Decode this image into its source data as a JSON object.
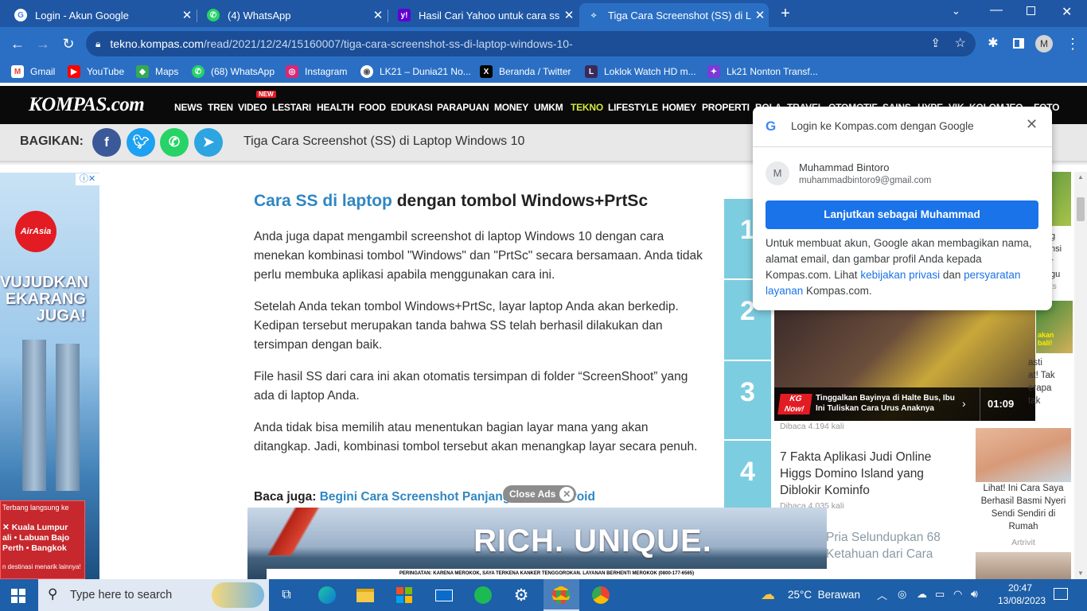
{
  "browser": {
    "tabs": [
      {
        "title": "Login - Akun Google"
      },
      {
        "title": "(4) WhatsApp"
      },
      {
        "title": "Hasil Cari Yahoo untuk cara ss di"
      },
      {
        "title": "Tiga Cara Screenshot (SS) di Lapt"
      }
    ],
    "url_host": "tekno.kompas.com",
    "url_path": "/read/2021/12/24/15160007/tiga-cara-screenshot-ss-di-laptop-windows-10-",
    "profile_initial": "M",
    "bookmarks": [
      "Gmail",
      "YouTube",
      "Maps",
      "(68) WhatsApp",
      "Instagram",
      "LK21 – Dunia21 No...",
      "Beranda / Twitter",
      "Loklok Watch HD m...",
      "Lk21 Nonton Transf..."
    ]
  },
  "site": {
    "logo": "KOMPAS.com",
    "nav": [
      "NEWS",
      "TREN",
      "VIDEO",
      "LESTARI",
      "HEALTH",
      "FOOD",
      "EDUKASI",
      "PARAPUAN",
      "MONEY",
      "UMKM",
      "TEKNO",
      "LIFESTYLE",
      "HOMEY",
      "PROPERTI",
      "BOLA",
      "TRAVEL",
      "OTOMOTIF",
      "SAINS",
      "HYPE",
      "VIK",
      "KOLOM",
      "JEO",
      "FOTO"
    ],
    "new_badge": "NEW",
    "share_label": "BAGIKAN:",
    "sticky_title": "Tiga Cara Screenshot (SS) di Laptop Windows 10"
  },
  "article": {
    "heading_link": "Cara SS di laptop",
    "heading_rest": " dengan tombol Windows+PrtSc",
    "paragraphs": [
      "Anda juga dapat mengambil screenshot di laptop Windows 10 dengan cara menekan kombinasi tombol \"Windows\" dan \"PrtSc\" secara bersamaan. Anda tidak perlu membuka aplikasi apabila menggunakan cara ini.",
      "Setelah Anda tekan tombol Windows+PrtSc, layar laptop Anda akan berkedip. Kedipan tersebut merupakan tanda bahwa SS telah berhasil dilakukan dan tersimpan dengan baik.",
      "File hasil SS dari cara ini akan otomatis tersimpan di folder “ScreenShoot” yang ada di laptop Anda.",
      "Anda tidak bisa memilih atau menentukan bagian layar mana yang akan ditangkap. Jadi, kombinasi tombol tersebut akan menangkap layar secara penuh."
    ],
    "baca_juga_label": "Baca juga:",
    "baca_juga_link": "Begini Cara Screenshot Panjang di HP Android"
  },
  "popular": {
    "ranks": [
      "1",
      "2",
      "3",
      "4"
    ],
    "item3_meta": "Dibaca 4.194 kali",
    "item4_title": "7 Fakta Aplikasi Judi Online Higgs Domino Island yang Diblokir Kominfo",
    "item4_meta": "Dibaca 4.035 kali",
    "item5_partial": "Pria Selundupkan 68 Ketahuan dari Cara"
  },
  "video": {
    "badge": "KG Now!",
    "caption": "Tinggalkan Bayinya di Halte Bus, Ibu Ini Tuliskan Cara Urus Anaknya",
    "duration": "01:09"
  },
  "sidebar_right": {
    "fragments1": [
      "g",
      "nsi",
      "r",
      "gu",
      "ts"
    ],
    "fragments2": [
      "akan",
      "bali!",
      "asti",
      "at! Tak",
      "erapa",
      "tak"
    ],
    "caption": "Lihat! Ini Cara Saya Berhasil Basmi Nyeri Sendi Sendiri di Rumah",
    "source": "Artrivit"
  },
  "ad_left": {
    "brand": "AirAsia",
    "headline": [
      "VUJUDKAN",
      "EKARANG",
      "JUGA!"
    ],
    "intro": "Terbang langsung ke",
    "routes": [
      "✕ Kuala Lumpur",
      "ali  •  Labuan Bajo",
      "Perth  •  Bangkok"
    ],
    "footer": "n destinasi menarik lainnya!"
  },
  "ad_bottom": {
    "close_label": "Close Ads",
    "tagline": "RICH. UNIQUE.",
    "warning": "PERINGATAN: KARENA MEROKOK, SAYA TERKENA KANKER TENGGOROKAN. LAYANAN BERHENTI MEROKOK (0800-177-6565)"
  },
  "google_popup": {
    "title": "Login ke Kompas.com dengan Google",
    "avatar": "M",
    "name": "Muhammad Bintoro",
    "email": "muhammadbintoro9@gmail.com",
    "button": "Lanjutkan sebagai Muhammad",
    "text1": "Untuk membuat akun, Google akan membagikan nama, alamat email, dan gambar profil Anda kepada Kompas.com. Lihat ",
    "link1": "kebijakan privasi",
    "text2": " dan ",
    "link2": "persyaratan layanan",
    "text3": " Kompas.com."
  },
  "taskbar": {
    "search_placeholder": "Type here to search",
    "weather": "25°C  Berawan",
    "time": "20:47",
    "date": "13/08/2023"
  },
  "colors": {
    "chrome_frame": "#1f57a5",
    "chrome_toolbar": "#2b6fc4",
    "kompas_link": "#2f87c2",
    "rank_bg": "#7dcde0",
    "google_blue": "#1a73e8",
    "taskbar": "#1d5fa8"
  }
}
